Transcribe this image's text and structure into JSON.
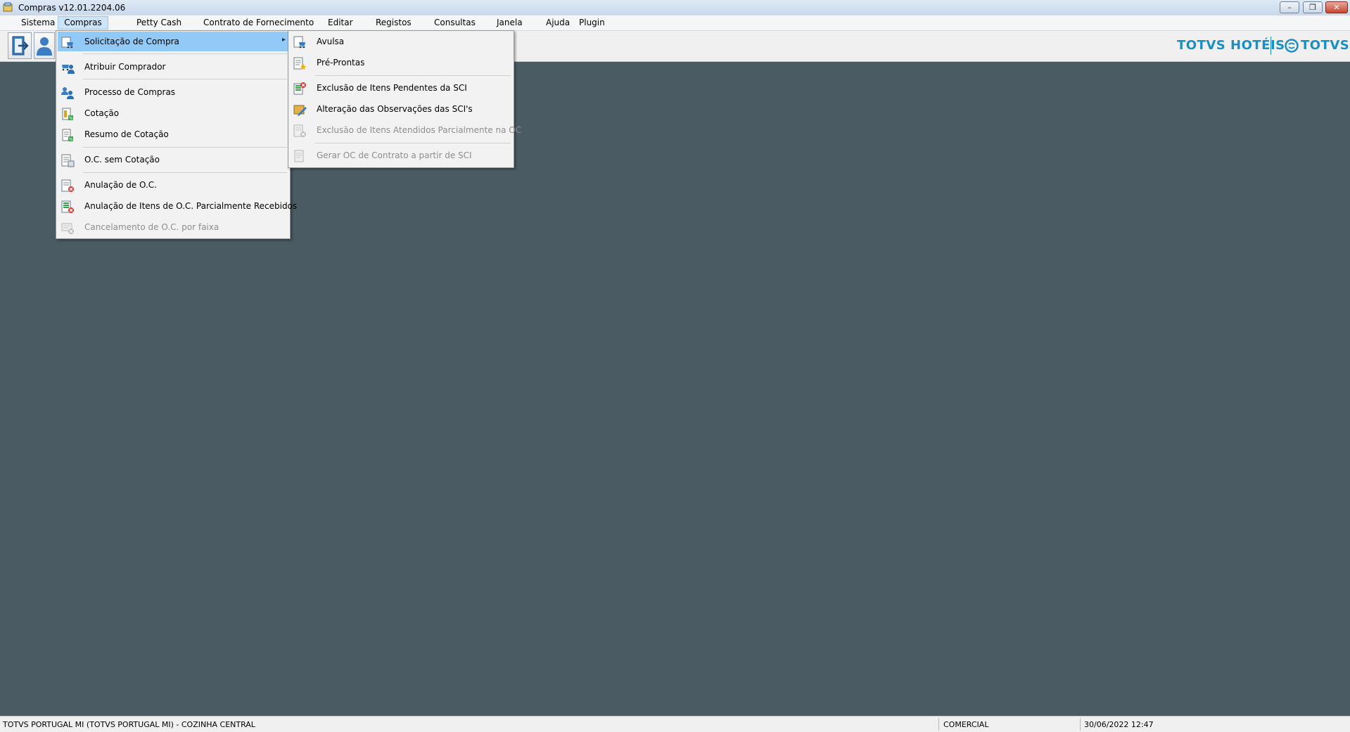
{
  "window": {
    "title": "Compras v12.01.2204.06",
    "minimize": "–",
    "restore": "❐",
    "close": "✕"
  },
  "menubar": [
    {
      "label": "Sistema"
    },
    {
      "label": "Compras"
    },
    {
      "label": "Petty Cash"
    },
    {
      "label": "Contrato de Fornecimento"
    },
    {
      "label": "Editar"
    },
    {
      "label": "Registos"
    },
    {
      "label": "Consultas"
    },
    {
      "label": "Janela"
    },
    {
      "label": "Ajuda"
    },
    {
      "label": "Plugin"
    }
  ],
  "brand": {
    "hoteis": "TOTVS HOTÉIS",
    "totvs": "TOTVS",
    "color": "#1a8fc4"
  },
  "compras_menu": [
    {
      "label": "Solicitação de Compra",
      "icon": "cart-request-icon",
      "submenu_arrow": "▸"
    },
    {
      "label": "Atribuir Comprador",
      "icon": "assign-buyer-icon"
    },
    {
      "label": "Processo de Compras",
      "icon": "people-process-icon"
    },
    {
      "label": "Cotação",
      "icon": "quote-icon"
    },
    {
      "label": "Resumo  de Cotação",
      "icon": "quote-summary-icon"
    },
    {
      "label": "O.C. sem Cotação",
      "icon": "order-no-quote-icon"
    },
    {
      "label": "Anulação de O.C.",
      "icon": "cancel-order-icon"
    },
    {
      "label": "Anulação de Itens de O.C. Parcialmente Recebidos",
      "icon": "cancel-items-icon"
    },
    {
      "label": "Cancelamento de O.C. por faixa",
      "icon": "cancel-range-icon"
    }
  ],
  "solicitacao_submenu": [
    {
      "label": "Avulsa",
      "icon": "single-request-icon"
    },
    {
      "label": "Pré-Prontas",
      "icon": "preset-request-icon"
    },
    {
      "label": "Exclusão de Itens Pendentes da SCI",
      "icon": "delete-pending-icon"
    },
    {
      "label": "Alteração das Observações das SCI's",
      "icon": "edit-notes-icon"
    },
    {
      "label": "Exclusão de Itens Atendidos Parcialmente na OC",
      "icon": "delete-partial-icon"
    },
    {
      "label": "Gerar OC de Contrato a partir de SCI",
      "icon": "generate-order-icon"
    }
  ],
  "statusbar": {
    "company": "TOTVS PORTUGAL MI (TOTVS PORTUGAL MI) - COZINHA CENTRAL",
    "module": "COMERCIAL",
    "datetime": "30/06/2022 12:47"
  }
}
